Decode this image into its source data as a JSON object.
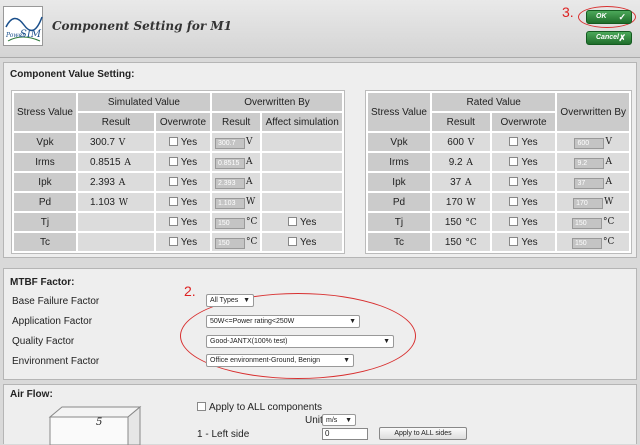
{
  "header": {
    "logo_text_1": "Power",
    "logo_text_2": "SIM",
    "title": "Component Setting for M1",
    "ok_label": "OK",
    "cancel_label": "Cancel",
    "annotation_3": "3."
  },
  "component_value": {
    "section_title": "Component Value Setting:",
    "left": {
      "h_stress": "Stress Value",
      "h_simulated": "Simulated Value",
      "h_overwritten_by": "Overwritten By",
      "h_result": "Result",
      "h_overwrote": "Overwrote",
      "h_result2": "Result",
      "h_affect": "Affect simulation",
      "rows": [
        {
          "name": "Vpk",
          "result": "300.7",
          "unit": "V",
          "yes": "Yes",
          "ov_value": "300.7",
          "ov_unit": "V",
          "affect": ""
        },
        {
          "name": "Irms",
          "result": "0.8515",
          "unit": "A",
          "yes": "Yes",
          "ov_value": "0.8515",
          "ov_unit": "A",
          "affect": ""
        },
        {
          "name": "Ipk",
          "result": "2.393",
          "unit": "A",
          "yes": "Yes",
          "ov_value": "2.393",
          "ov_unit": "A",
          "affect": ""
        },
        {
          "name": "Pd",
          "result": "1.103",
          "unit": "W",
          "yes": "Yes",
          "ov_value": "1.103",
          "ov_unit": "W",
          "affect": ""
        },
        {
          "name": "Tj",
          "result": "",
          "unit": "",
          "yes": "Yes",
          "ov_value": "150",
          "ov_unit": "°C",
          "affect": "Yes"
        },
        {
          "name": "Tc",
          "result": "",
          "unit": "",
          "yes": "Yes",
          "ov_value": "150",
          "ov_unit": "°C",
          "affect": "Yes"
        }
      ]
    },
    "right": {
      "h_stress": "Stress Value",
      "h_rated": "Rated Value",
      "h_overwritten_by": "Overwritten By",
      "h_result": "Result",
      "h_overwrote": "Overwrote",
      "rows": [
        {
          "name": "Vpk",
          "result": "600",
          "unit": "V",
          "yes": "Yes",
          "ov_value": "600",
          "ov_unit": "V"
        },
        {
          "name": "Irms",
          "result": "9.2",
          "unit": "A",
          "yes": "Yes",
          "ov_value": "9.2",
          "ov_unit": "A"
        },
        {
          "name": "Ipk",
          "result": "37",
          "unit": "A",
          "yes": "Yes",
          "ov_value": "37",
          "ov_unit": "A"
        },
        {
          "name": "Pd",
          "result": "170",
          "unit": "W",
          "yes": "Yes",
          "ov_value": "170",
          "ov_unit": "W"
        },
        {
          "name": "Tj",
          "result": "150",
          "unit": "°C",
          "yes": "Yes",
          "ov_value": "150",
          "ov_unit": "°C"
        },
        {
          "name": "Tc",
          "result": "150",
          "unit": "°C",
          "yes": "Yes",
          "ov_value": "150",
          "ov_unit": "°C"
        }
      ]
    }
  },
  "mtbf": {
    "section_title": "MTBF Factor:",
    "annotation_2": "2.",
    "base_label": "Base Failure Factor",
    "base_value": "All Types",
    "app_label": "Application Factor",
    "app_value": "50W<=Power rating<250W",
    "quality_label": "Quality Factor",
    "quality_value": "Good-JANTX(100% test)",
    "env_label": "Environment Factor",
    "env_value": "Office environment-Ground, Benign"
  },
  "airflow": {
    "section_title": "Air Flow:",
    "cube_label": "5",
    "apply_all_label": "Apply to ALL components",
    "unit_label": "Unit",
    "unit_value": "m/s",
    "side1_label": "1 - Left side",
    "side1_value": "0",
    "apply_sides_label": "Apply to ALL sides"
  }
}
